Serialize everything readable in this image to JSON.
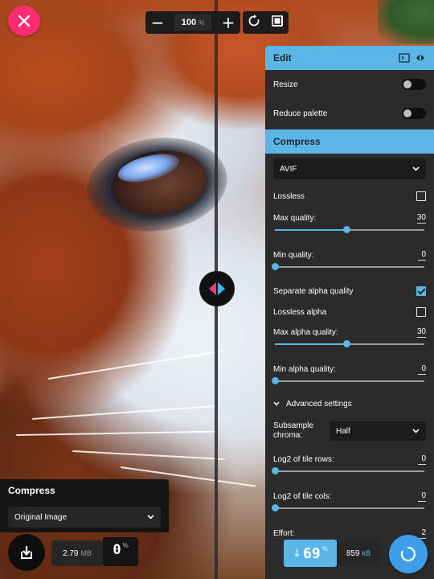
{
  "zoom": {
    "value": "100",
    "unit": "%",
    "minus": "−",
    "plus": "+"
  },
  "panel": {
    "edit_title": "Edit",
    "resize_label": "Resize",
    "reduce_palette_label": "Reduce palette",
    "compress_title": "Compress",
    "format": "AVIF",
    "lossless_label": "Lossless",
    "max_quality_label": "Max quality:",
    "max_quality_value": "30",
    "max_quality_fraction": 0.48,
    "min_quality_label": "Min quality:",
    "min_quality_value": "0",
    "min_quality_fraction": 0,
    "separate_alpha_label": "Separate alpha quality",
    "lossless_alpha_label": "Lossless alpha",
    "max_alpha_quality_label": "Max alpha quality:",
    "max_alpha_quality_value": "30",
    "max_alpha_quality_fraction": 0.48,
    "min_alpha_quality_label": "Min alpha quality:",
    "min_alpha_quality_value": "0",
    "min_alpha_quality_fraction": 0,
    "advanced_label": "Advanced settings",
    "subsample_label_1": "Subsample",
    "subsample_label_2": "chroma:",
    "subsample_value": "Half",
    "tile_rows_label": "Log2 of tile rows:",
    "tile_rows_value": "0",
    "tile_rows_fraction": 0,
    "tile_cols_label": "Log2 of tile cols:",
    "tile_cols_value": "0",
    "tile_cols_fraction": 0,
    "effort_label": "Effort:",
    "effort_value": "2"
  },
  "left": {
    "title": "Compress",
    "select_value": "Original Image",
    "size_value": "2.79",
    "size_unit": "MB",
    "pct_value": "0",
    "pct_unit": "%"
  },
  "right": {
    "arrow": "↓",
    "pct_value": "69",
    "pct_unit": "%",
    "size_value": "859",
    "size_unit": "kB"
  },
  "colors": {
    "accent": "#5bb6e8",
    "close": "#ff2d6f",
    "panel_bg": "#2b2b2b"
  }
}
